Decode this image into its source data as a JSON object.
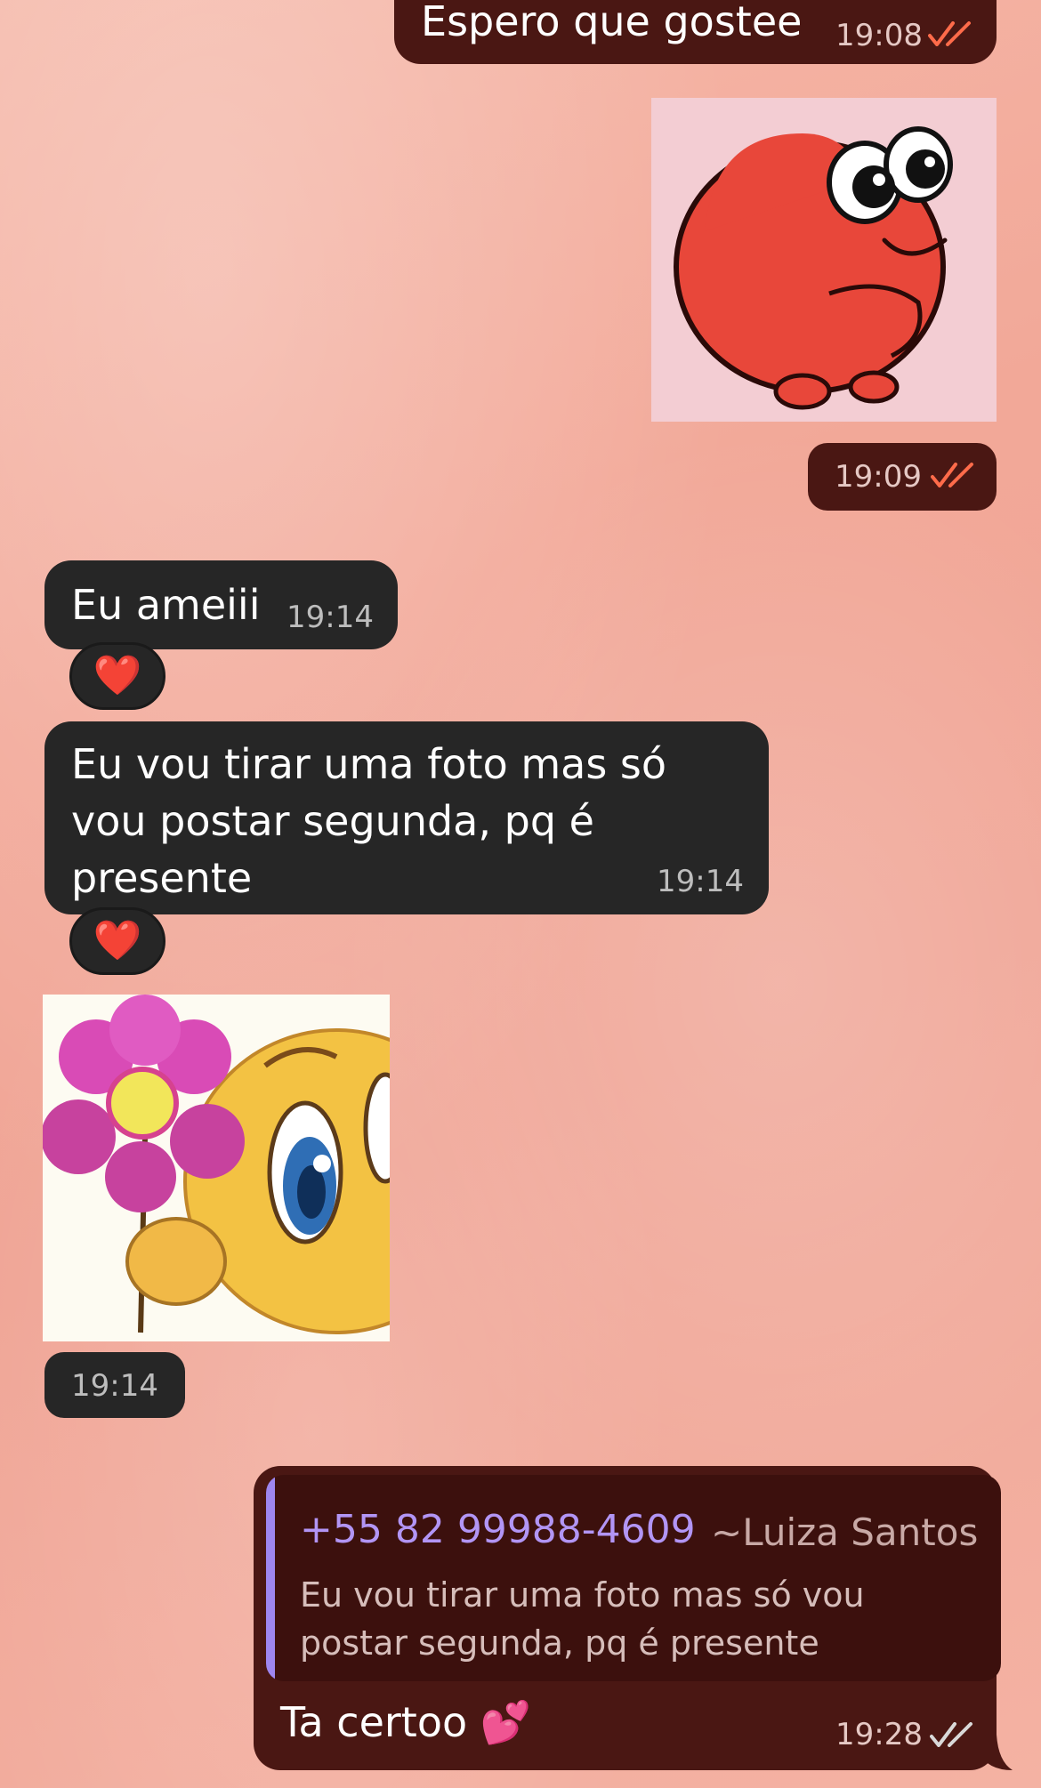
{
  "messages": [
    {
      "text": "Espero que gostee",
      "time": "19:08",
      "status": "read"
    },
    {
      "sticker": "heart-character-sticker",
      "time": "19:09",
      "status": "read"
    },
    {
      "text": "Eu ameiii",
      "time": "19:14",
      "reaction": "❤️"
    },
    {
      "text": "Eu vou tirar uma foto mas só vou postar segunda, pq é presente",
      "time": "19:14",
      "reaction": "❤️"
    },
    {
      "sticker": "smiley-flower-sticker",
      "time": "19:14"
    },
    {
      "reply": {
        "phone": "+55 82 99988-4609",
        "name": "~Luiza Santos",
        "text": "Eu vou tirar uma foto mas só vou postar segunda, pq é presente"
      },
      "text": "Ta certoo 💕",
      "time": "19:28",
      "status": "delivered"
    }
  ],
  "colors": {
    "outgoing_bubble": "#4a1713",
    "incoming_bubble": "#262626",
    "read_ticks": "#ff6b4a",
    "delivered_ticks": "#d9d9d9",
    "reply_accent": "#9e86ef"
  }
}
